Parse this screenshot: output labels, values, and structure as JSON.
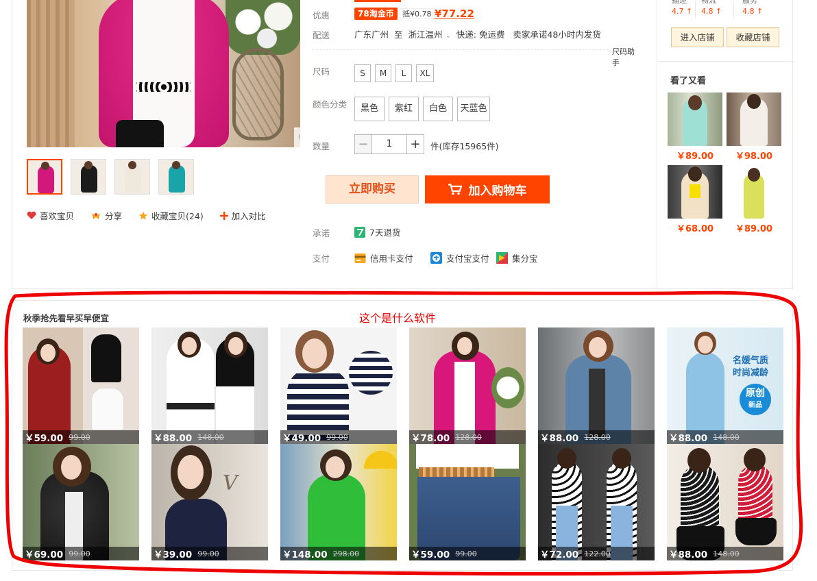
{
  "detail": {
    "promo_label": "优惠",
    "coupon_badge": "78淘金币",
    "coupon_offset": "抵¥0.78",
    "coupon_price": "¥77.22",
    "ship_label": "配送",
    "ship_from": "广东广州",
    "ship_to_word": "至",
    "ship_to": "浙江温州",
    "ship_dropdown_glyph": "⌄",
    "ship_method": "快递: 免运费",
    "ship_promise": "卖家承诺48小时内发货",
    "size_helper": "尺码助手",
    "size_label": "尺码",
    "sizes": [
      "S",
      "M",
      "L",
      "XL"
    ],
    "color_label": "颜色分类",
    "colors": [
      "黑色",
      "紫红",
      "白色",
      "天蓝色"
    ],
    "qty_label": "数量",
    "qty_minus": "−",
    "qty_value": "1",
    "qty_plus": "+",
    "qty_stock": "件(库存15965件)",
    "buy_now": "立即购买",
    "add_cart": "加入购物车",
    "promise_label": "承诺",
    "promise_item": "7天退货",
    "pay_label": "支付",
    "pay_methods": [
      "信用卡支付",
      "支付宝支付",
      "集分宝"
    ]
  },
  "gallery": {
    "actions": [
      "喜欢宝贝",
      "分享",
      "收藏宝贝(24)",
      "加入对比"
    ]
  },
  "shop": {
    "scores": [
      {
        "label": "描述",
        "value": "4.7"
      },
      {
        "label": "物流",
        "value": "4.8"
      },
      {
        "label": "服务",
        "value": "4.8"
      }
    ],
    "score_arrow": "↑",
    "enter_shop": "进入店铺",
    "fav_shop": "收藏店铺",
    "seen_title": "看了又看",
    "seen_items": [
      {
        "price": "￥89.00"
      },
      {
        "price": "￥98.00"
      },
      {
        "price": "￥68.00"
      },
      {
        "price": "￥89.00"
      }
    ]
  },
  "recommend": {
    "title": "秋季抢先看早买早便宜",
    "annotation": "这个是什么软件",
    "items": [
      {
        "price": "￥59.00",
        "old": "99.00"
      },
      {
        "price": "￥88.00",
        "old": "148.00"
      },
      {
        "price": "￥49.00",
        "old": "99.00"
      },
      {
        "price": "￥78.00",
        "old": "128.00"
      },
      {
        "price": "￥88.00",
        "old": "128.00"
      },
      {
        "price": "￥88.00",
        "old": "148.00",
        "badge_line1": "名媛气质",
        "badge_line2": "时尚减龄",
        "badge_circle1": "原创",
        "badge_circle2": "新品"
      },
      {
        "price": "￥69.00",
        "old": "99.00"
      },
      {
        "price": "￥39.00",
        "old": "99.00"
      },
      {
        "price": "￥148.00",
        "old": "298.00"
      },
      {
        "price": "￥59.00",
        "old": "99.00"
      },
      {
        "price": "￥72.00",
        "old": "122.00"
      },
      {
        "price": "￥88.00",
        "old": "148.00"
      }
    ]
  },
  "colors": {
    "accent": "#ff4400",
    "annotation_red": "#ee0000"
  }
}
